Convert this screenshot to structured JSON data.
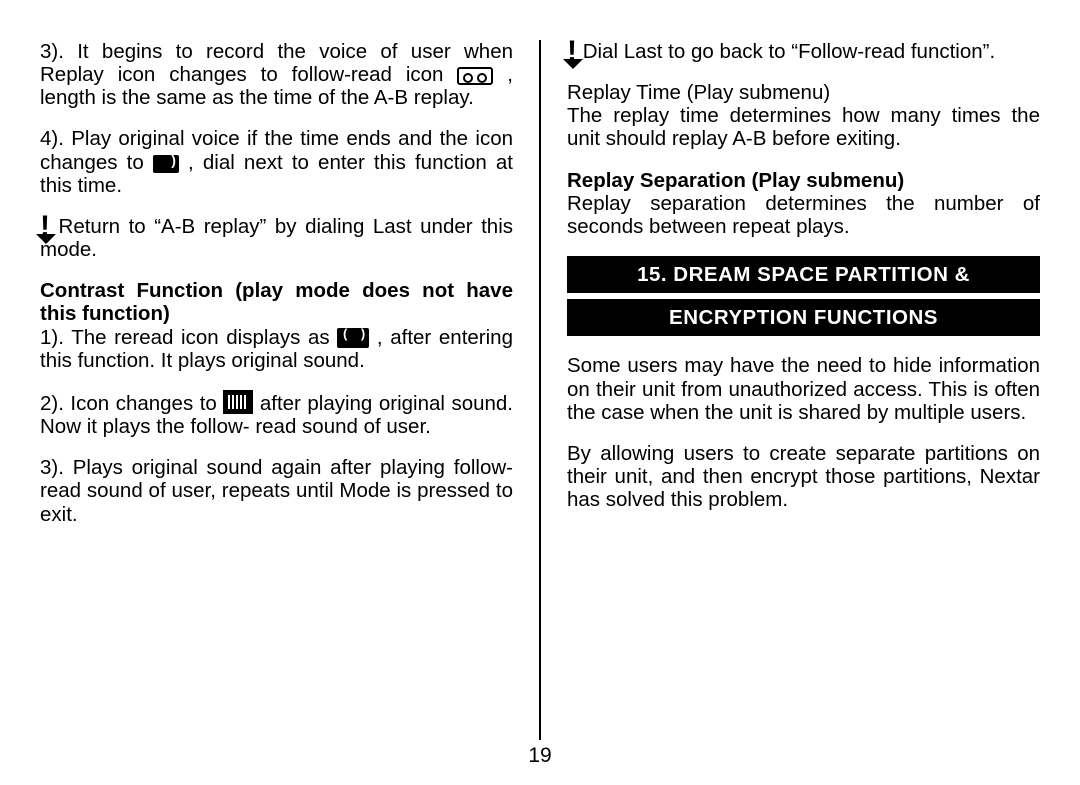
{
  "page_number": "19",
  "left": {
    "p1_a": "3). It begins to record the voice of user when Replay icon changes to follow-read icon ",
    "p1_b": ", length is the same as the time of the A-B replay.",
    "p2_a": "4). Play original voice if the time ends and the icon changes to ",
    "p2_b": ", dial next to enter this function at this time.",
    "note1": "Return to “A-B replay” by dialing Last under this mode.",
    "h1": "Contrast Function (play mode does not have this function)",
    "p3_a": "1). The reread icon displays as ",
    "p3_b": ", after entering this function. It plays original sound.",
    "p4_a": "2). Icon changes to ",
    "p4_b": " after playing original sound. Now it plays the follow- read sound of user.",
    "p5": "3). Plays original sound again after playing follow-read sound of user, repeats until Mode is pressed to exit."
  },
  "right": {
    "note1": "Dial Last to go back to “Follow-read function”.",
    "h_rt": "Replay Time (Play submenu)",
    "p_rt": "The replay time determines how many times the unit should replay A-B before exiting.",
    "h_rs": "Replay Separation (Play submenu)",
    "p_rs": "Replay separation determines the number of seconds between repeat plays.",
    "section_a": "15. DREAM SPACE PARTITION &",
    "section_b": "ENCRYPTION FUNCTIONS",
    "p_enc1": "Some users may have the need to hide information on their unit from unauthorized access.  This is often the case when the unit is shared by multiple users.",
    "p_enc2": "By allowing users to create separate partitions on their unit, and then encrypt those partitions, Nextar has solved this problem."
  },
  "icons": {
    "cassette": "cassette-icon",
    "speaker": "speaker-icon",
    "dualspk": "dual-speaker-icon",
    "speaker_bordered": "speaker-bordered-icon",
    "exclaim": "exclamation-icon"
  }
}
